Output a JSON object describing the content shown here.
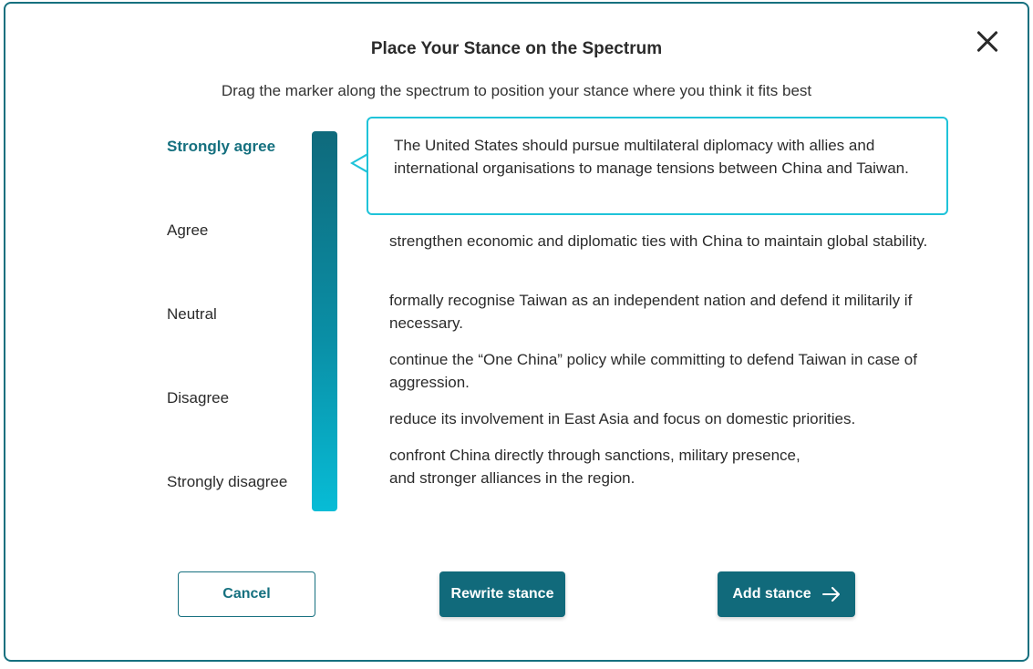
{
  "dialog": {
    "title": "Place Your Stance on the Spectrum",
    "subtitle": "Drag the marker along the spectrum to position your stance where you think it fits best",
    "close_icon": "close-icon"
  },
  "scale": {
    "labels": [
      "Strongly agree",
      "Agree",
      "Neutral",
      "Disagree",
      "Strongly disagree"
    ],
    "selected": "Strongly agree",
    "gradient_colors": [
      "#0f6a7c",
      "#07bcd6"
    ]
  },
  "current_stance": {
    "text": "The United States should pursue multilateral diplomacy with allies and international organisations to manage tensions between China and Taiwan."
  },
  "options": [
    "strengthen economic and diplomatic ties with China to maintain global stability.",
    "formally recognise Taiwan as an independent nation and defend it militarily if necessary.",
    "continue the “One China” policy while committing to defend Taiwan in case of aggression.",
    "reduce its involvement in East Asia and focus on domestic priorities.",
    "confront China directly through sanctions, military presence,\nand stronger alliances in the region."
  ],
  "buttons": {
    "cancel": "Cancel",
    "rewrite": "Rewrite stance",
    "add": "Add stance",
    "add_icon": "arrow-right-icon"
  },
  "colors": {
    "accent": "#116a7b",
    "callout_border": "#1fc3d9"
  }
}
